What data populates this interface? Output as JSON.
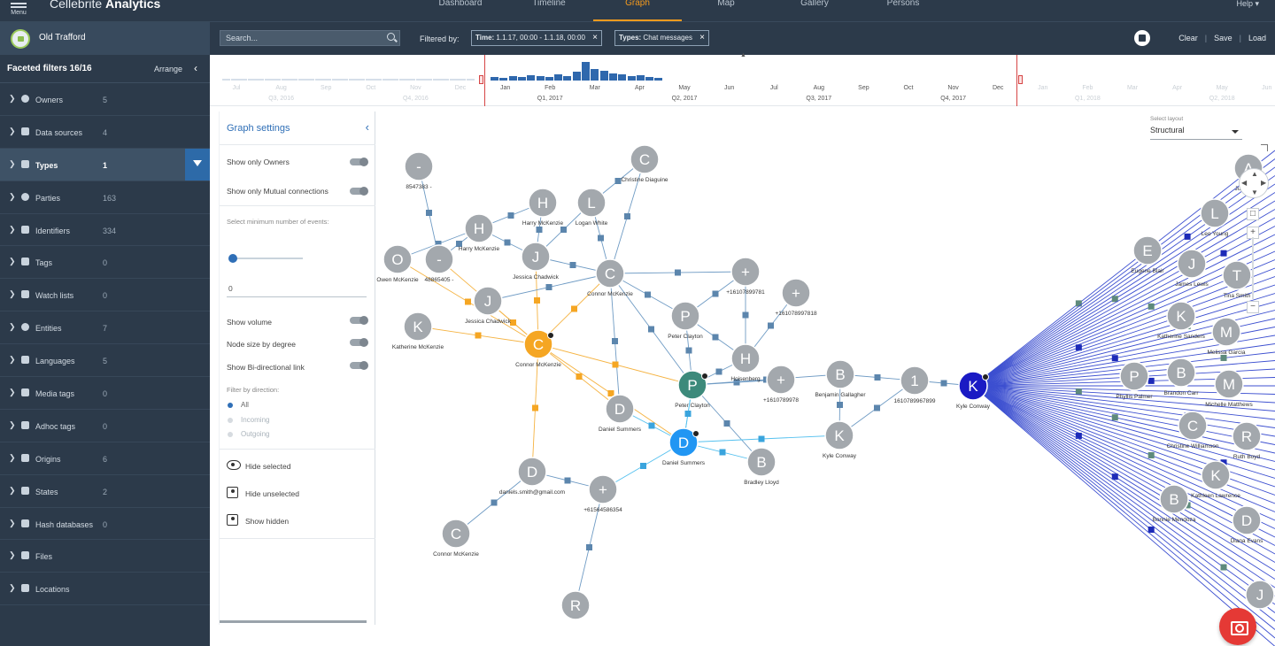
{
  "app": {
    "brand_prefix": "Cellebrite ",
    "brand_name": "Analytics",
    "menu_label": "Menu"
  },
  "nav": {
    "tabs": [
      "Dashboard",
      "Timeline",
      "Graph",
      "Map",
      "Gallery",
      "Persons"
    ],
    "active": "Graph",
    "help": "Help ▾"
  },
  "case": {
    "name": "Old Trafford"
  },
  "search": {
    "placeholder": "Search..."
  },
  "filters": {
    "label": "Filtered by:",
    "chips": [
      {
        "key": "Time:",
        "value": " 1.1.17, 00:00 - 1.1.18, 00:00"
      },
      {
        "key": "Types:",
        "value": " Chat messages"
      }
    ]
  },
  "actions": {
    "clear": "Clear",
    "save": "Save",
    "load": "Load",
    "sep": "|"
  },
  "sidebar": {
    "title": "Faceted filters 16/16",
    "arrange": "Arrange",
    "facets": [
      {
        "label": "Owners",
        "count": "5",
        "icon": "person-icon"
      },
      {
        "label": "Data sources",
        "count": "4",
        "icon": "data-source-icon"
      },
      {
        "label": "Types",
        "count": "1",
        "icon": "grid-icon",
        "selected": true
      },
      {
        "label": "Parties",
        "count": "163",
        "icon": "person-icon"
      },
      {
        "label": "Identifiers",
        "count": "334",
        "icon": "id-card-icon"
      },
      {
        "label": "Tags",
        "count": "0",
        "icon": "tag-icon"
      },
      {
        "label": "Watch lists",
        "count": "0",
        "icon": "list-icon"
      },
      {
        "label": "Entities",
        "count": "7",
        "icon": "globe-icon"
      },
      {
        "label": "Languages",
        "count": "5",
        "icon": "language-icon"
      },
      {
        "label": "Media tags",
        "count": "0",
        "icon": "image-icon"
      },
      {
        "label": "Adhoc tags",
        "count": "0",
        "icon": "image-icon"
      },
      {
        "label": "Origins",
        "count": "6",
        "icon": "phone-icon"
      },
      {
        "label": "States",
        "count": "2",
        "icon": "trash-icon"
      },
      {
        "label": "Hash databases",
        "count": "0",
        "icon": "document-icon"
      },
      {
        "label": "Files",
        "count": "",
        "icon": "files-icon"
      },
      {
        "label": "Locations",
        "count": "",
        "icon": "pin-icon"
      }
    ]
  },
  "timeline": {
    "months": [
      {
        "label": "Jul",
        "faded": true
      },
      {
        "label": "Aug",
        "faded": true
      },
      {
        "label": "Sep",
        "faded": true
      },
      {
        "label": "Oct",
        "faded": true
      },
      {
        "label": "Nov",
        "faded": true
      },
      {
        "label": "Dec",
        "faded": true
      },
      {
        "label": "Jan"
      },
      {
        "label": "Feb"
      },
      {
        "label": "Mar"
      },
      {
        "label": "Apr"
      },
      {
        "label": "May"
      },
      {
        "label": "Jun"
      },
      {
        "label": "Jul"
      },
      {
        "label": "Aug"
      },
      {
        "label": "Sep"
      },
      {
        "label": "Oct"
      },
      {
        "label": "Nov"
      },
      {
        "label": "Dec"
      },
      {
        "label": "Jan",
        "faded": true
      },
      {
        "label": "Feb",
        "faded": true
      },
      {
        "label": "Mar",
        "faded": true
      },
      {
        "label": "Apr",
        "faded": true
      },
      {
        "label": "May",
        "faded": true
      },
      {
        "label": "Jun",
        "faded": true
      }
    ],
    "quarters": [
      {
        "label": "Q3, 2016",
        "faded": true
      },
      {
        "label": "Q4, 2016",
        "faded": true
      },
      {
        "label": "Q1, 2017"
      },
      {
        "label": "Q2, 2017"
      },
      {
        "label": "Q3, 2017"
      },
      {
        "label": "Q4, 2017"
      },
      {
        "label": "Q1, 2018",
        "faded": true
      },
      {
        "label": "Q2, 2018",
        "faded": true
      }
    ]
  },
  "graph_settings": {
    "title": "Graph settings",
    "show_only_owners": "Show only Owners",
    "show_mutual": "Show only Mutual connections",
    "min_events": "Select minimum number of events:",
    "min_events_value": "0",
    "show_volume": "Show volume",
    "node_size": "Node size by degree",
    "bidirectional": "Show Bi-directional link",
    "filter_dir": "Filter by direction:",
    "dir_all": "All",
    "dir_incoming": "Incoming",
    "dir_outgoing": "Outgoing",
    "hide_selected": "Hide selected",
    "hide_unselected": "Hide unselected",
    "show_hidden": "Show hidden"
  },
  "layout": {
    "label": "Select layout",
    "value": "Structural"
  },
  "colors": {
    "owner_orange": "#f5a623",
    "owner_green": "#3d8a7b",
    "owner_blue": "#2196f3",
    "selected_navy": "#1a1ac4",
    "node_grey": "#a3a8ad",
    "edge": "#4f8ac2"
  },
  "graph": {
    "nodes": [
      {
        "letter": "-",
        "name": "8547383 -",
        "type": "grey"
      },
      {
        "letter": "C",
        "name": "Christine Diaguine",
        "type": "grey"
      },
      {
        "letter": "H",
        "name": "Harry McKenzie",
        "type": "grey"
      },
      {
        "letter": "L",
        "name": "Logan White",
        "type": "grey"
      },
      {
        "letter": "H",
        "name": "Harry McKenzie",
        "type": "grey"
      },
      {
        "letter": "O",
        "name": "Owen McKenzie",
        "type": "grey"
      },
      {
        "letter": "-",
        "name": "48865405 -",
        "type": "grey"
      },
      {
        "letter": "J",
        "name": "Jessica Chadwick",
        "type": "grey"
      },
      {
        "letter": "C",
        "name": "Connor McKenzie",
        "type": "grey"
      },
      {
        "letter": "J",
        "name": "Jessica Chadwick",
        "type": "grey"
      },
      {
        "letter": "K",
        "name": "Katherine McKenzie",
        "type": "grey"
      },
      {
        "letter": "C",
        "name": "Connor McKenzie",
        "type": "orange"
      },
      {
        "letter": "+",
        "name": "+16107899781",
        "type": "grey"
      },
      {
        "letter": "+",
        "name": "+161078997818",
        "type": "grey"
      },
      {
        "letter": "P",
        "name": "Peter Clayton",
        "type": "grey"
      },
      {
        "letter": "H",
        "name": "Hoisenberg",
        "type": "grey"
      },
      {
        "letter": "P",
        "name": "Peter Clayton",
        "type": "green"
      },
      {
        "letter": "+",
        "name": "+1610789978",
        "type": "grey"
      },
      {
        "letter": "B",
        "name": "Benjamin Gallagher",
        "type": "grey"
      },
      {
        "letter": "1",
        "name": "1610789967899",
        "type": "grey"
      },
      {
        "letter": "K",
        "name": "Kyle Conway",
        "type": "navy"
      },
      {
        "letter": "D",
        "name": "Daniel Summers",
        "type": "grey"
      },
      {
        "letter": "D",
        "name": "Daniel Summers",
        "type": "blue"
      },
      {
        "letter": "B",
        "name": "Bradley Lloyd",
        "type": "grey"
      },
      {
        "letter": "K",
        "name": "Kyle Conway",
        "type": "grey"
      },
      {
        "letter": "D",
        "name": "daniels.smith@gmail.com",
        "type": "grey"
      },
      {
        "letter": "+",
        "name": "+61564586354",
        "type": "grey"
      },
      {
        "letter": "C",
        "name": "Connor McKenzie",
        "type": "grey"
      },
      {
        "letter": "R",
        "name": "",
        "type": "grey"
      },
      {
        "letter": "A",
        "name": "Julia Hicks",
        "type": "grey"
      },
      {
        "letter": "L",
        "name": "Leo Young",
        "type": "grey"
      },
      {
        "letter": "E",
        "name": "Eugene Blair",
        "type": "grey"
      },
      {
        "letter": "J",
        "name": "James Lewis",
        "type": "grey"
      },
      {
        "letter": "T",
        "name": "Tina Smith",
        "type": "grey"
      },
      {
        "letter": "K",
        "name": "Katherine Sanders",
        "type": "grey"
      },
      {
        "letter": "M",
        "name": "Melissa Garcia",
        "type": "grey"
      },
      {
        "letter": "P",
        "name": "Phyllis Palmer",
        "type": "grey"
      },
      {
        "letter": "B",
        "name": "Brandon Carr",
        "type": "grey"
      },
      {
        "letter": "M",
        "name": "Michelle Matthews",
        "type": "grey"
      },
      {
        "letter": "C",
        "name": "Christine Williamson",
        "type": "grey"
      },
      {
        "letter": "R",
        "name": "Ruth Boyd",
        "type": "grey"
      },
      {
        "letter": "K",
        "name": "Kathleen Lawrence",
        "type": "grey"
      },
      {
        "letter": "B",
        "name": "Bonnie Mendoza",
        "type": "grey"
      },
      {
        "letter": "D",
        "name": "Diana Evans",
        "type": "grey"
      },
      {
        "letter": "J",
        "name": "",
        "type": "grey"
      }
    ]
  }
}
